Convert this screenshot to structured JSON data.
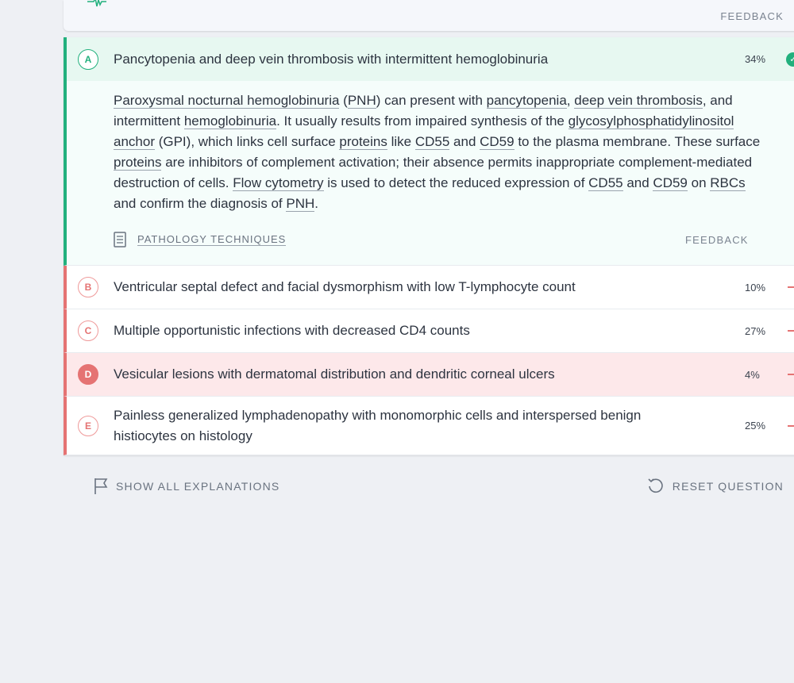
{
  "top": {
    "feedback_label": "FEEDBACK"
  },
  "options": [
    {
      "letter": "A",
      "text": "Pancytopenia and deep vein thrombosis with intermittent hemoglobinuria",
      "percent": "34%",
      "status": "correct"
    },
    {
      "letter": "B",
      "text": "Ventricular septal defect and facial dysmorphism with low T-lymphocyte count",
      "percent": "10%",
      "status": "incorrect"
    },
    {
      "letter": "C",
      "text": "Multiple opportunistic infections with decreased CD4 counts",
      "percent": "27%",
      "status": "incorrect"
    },
    {
      "letter": "D",
      "text": "Vesicular lesions with dermatomal distribution and dendritic corneal ulcers",
      "percent": "4%",
      "status": "selected-incorrect"
    },
    {
      "letter": "E",
      "text": "Painless generalized lymphadenopathy with monomorphic cells and interspersed benign histiocytes on histology",
      "percent": "25%",
      "status": "incorrect"
    }
  ],
  "explanation": {
    "parts": {
      "p1": "Paroxysmal nocturnal hemoglobinuria",
      "p2": " (",
      "p3": "PNH",
      "p4": ") can present with ",
      "p5": "pancytopenia",
      "p6": ", ",
      "p7": "deep vein thrombosis",
      "p8": ", and intermittent ",
      "p9": "hemoglobinuria",
      "p10": ". It usually results from impaired synthesis of the ",
      "p11": "glycosylphosphatidylinositol anchor",
      "p12": " (GPI), which links cell surface ",
      "p13": "proteins",
      "p14": " like ",
      "p15": "CD55",
      "p16": " and ",
      "p17": "CD59",
      "p18": " to the plasma membrane. These surface ",
      "p19": "proteins",
      "p20": " are inhibitors of complement activation; their absence permits inappropriate complement-mediated destruction of cells. ",
      "p21": "Flow cytometry",
      "p22": " is used to detect the reduced expression of ",
      "p23": "CD55",
      "p24": " and ",
      "p25": "CD59",
      "p26": " on ",
      "p27": "RBCs",
      "p28": " and confirm the diagnosis of ",
      "p29": "PNH",
      "p30": "."
    },
    "topic_label": "PATHOLOGY TECHNIQUES",
    "feedback_label": "FEEDBACK"
  },
  "footer": {
    "show_all_label": "SHOW ALL EXPLANATIONS",
    "reset_label": "RESET QUESTION"
  },
  "colors": {
    "correct": "#22b07d",
    "incorrect": "#e57373",
    "selected_bg": "#fde8ea",
    "correct_bg": "#e7f8f1"
  },
  "icons": {
    "check": "check-circle-icon",
    "document": "document-icon",
    "flag": "flag-icon",
    "reset": "reset-icon"
  }
}
